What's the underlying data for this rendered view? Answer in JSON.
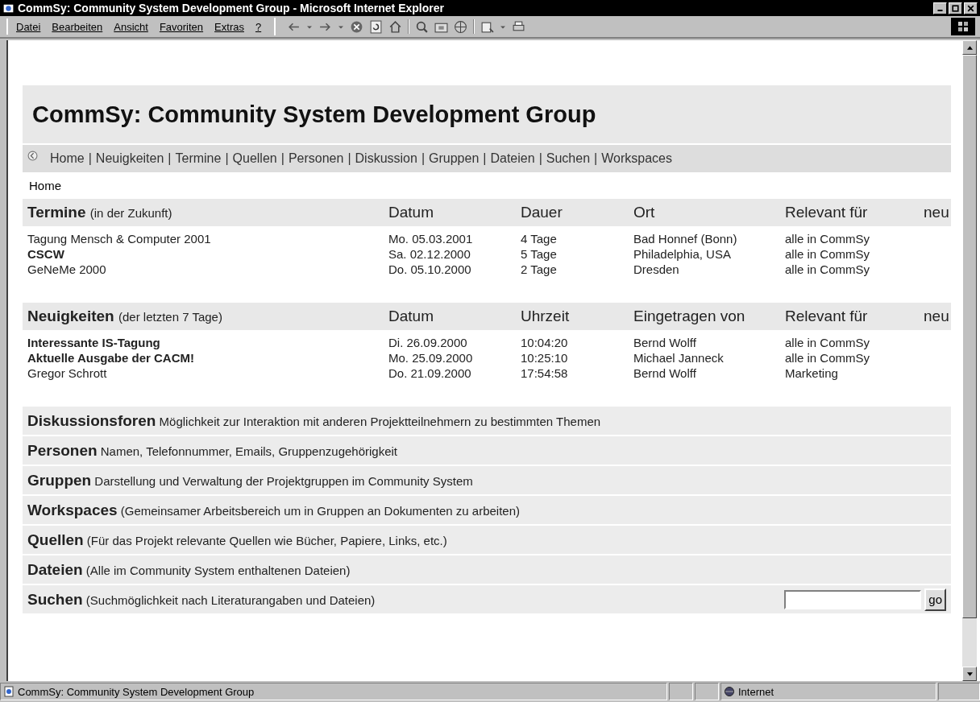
{
  "window": {
    "title": "CommSy: Community System Development Group - Microsoft Internet Explorer"
  },
  "menu": [
    "Datei",
    "Bearbeiten",
    "Ansicht",
    "Favoriten",
    "Extras",
    "?"
  ],
  "page": {
    "title": "CommSy: Community System Development Group",
    "nav_separator": "|",
    "nav": [
      "Home",
      "Neuigkeiten",
      "Termine",
      "Quellen",
      "Personen",
      "Diskussion",
      "Gruppen",
      "Dateien",
      "Suchen",
      "Workspaces"
    ],
    "breadcrumb": "Home",
    "tables": [
      {
        "columns": [
          {
            "label": "Termine",
            "note": "(in der Zukunft)"
          },
          {
            "label": "Datum"
          },
          {
            "label": "Dauer"
          },
          {
            "label": "Ort"
          },
          {
            "label": "Relevant für"
          },
          {
            "label": "neu"
          }
        ],
        "rows": [
          {
            "cells": [
              "Tagung Mensch & Computer 2001",
              "Mo. 05.03.2001",
              "4 Tage",
              "Bad Honnef (Bonn)",
              "alle in CommSy"
            ],
            "bold": false
          },
          {
            "cells": [
              "CSCW",
              "Sa. 02.12.2000",
              "5 Tage",
              "Philadelphia, USA",
              "alle in CommSy"
            ],
            "bold": true
          },
          {
            "cells": [
              "GeNeMe 2000",
              "Do. 05.10.2000",
              "2 Tage",
              "Dresden",
              "alle in CommSy"
            ],
            "bold": false
          }
        ]
      },
      {
        "columns": [
          {
            "label": "Neuigkeiten",
            "note": "(der letzten 7 Tage)"
          },
          {
            "label": "Datum"
          },
          {
            "label": "Uhrzeit"
          },
          {
            "label": "Eingetragen von"
          },
          {
            "label": "Relevant für"
          },
          {
            "label": "neu"
          }
        ],
        "rows": [
          {
            "cells": [
              "Interessante IS-Tagung",
              "Di. 26.09.2000",
              "10:04:20",
              "Bernd Wolff",
              "alle in CommSy"
            ],
            "bold": true
          },
          {
            "cells": [
              "Aktuelle Ausgabe der CACM!",
              "Mo. 25.09.2000",
              "10:25:10",
              "Michael Janneck",
              "alle in CommSy"
            ],
            "bold": true
          },
          {
            "cells": [
              "Gregor Schrott",
              "Do. 21.09.2000",
              "17:54:58",
              "Bernd Wolff",
              "Marketing"
            ],
            "bold": false
          }
        ]
      }
    ],
    "sections": [
      {
        "title": "Diskussionsforen",
        "text": "Möglichkeit zur Interaktion mit anderen Projektteilnehmern zu bestimmten Themen"
      },
      {
        "title": "Personen",
        "text": "Namen, Telefonnummer, Emails, Gruppenzugehörigkeit"
      },
      {
        "title": "Gruppen",
        "text": "Darstellung und Verwaltung der Projektgruppen im Community System"
      },
      {
        "title": "Workspaces",
        "text": "(Gemeinsamer Arbeitsbereich um in Gruppen an Dokumenten zu arbeiten)"
      },
      {
        "title": "Quellen",
        "text": "(Für das Projekt relevante Quellen wie Bücher, Papiere, Links, etc.)"
      },
      {
        "title": "Dateien",
        "text": "(Alle im Community System enthaltenen Dateien)"
      },
      {
        "title": "Suchen",
        "text": "(Suchmöglichkeit nach Literaturangaben und Dateien)",
        "kind": "search",
        "button": "go"
      }
    ]
  },
  "status_bar": {
    "text": "CommSy: Community System Development Group",
    "zone": "Internet"
  }
}
